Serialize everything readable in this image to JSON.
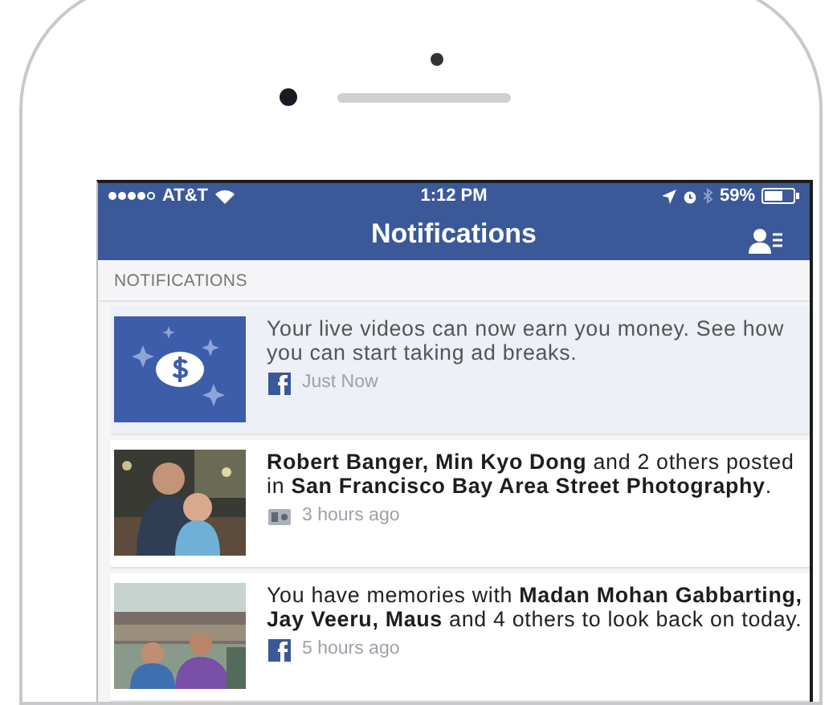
{
  "status_bar": {
    "carrier": "AT&T",
    "time": "1:12 PM",
    "battery": "59%"
  },
  "nav_bar": {
    "title": "Notifications"
  },
  "section_header": "NOTIFICATIONS",
  "notifications": [
    {
      "kind": "money",
      "unread": true,
      "text": "Your live videos can now earn you money. See how you can start taking ad breaks.",
      "source": {
        "kind": "facebook"
      },
      "time": "Just Now"
    },
    {
      "unread": false,
      "text": "**Robert Banger, Min Kyo Dong** and 2 others posted in **San Francisco Bay Area Street Photography**.",
      "source": {
        "kind": "group"
      },
      "time": "3 hours ago"
    },
    {
      "unread": false,
      "text": "You have memories with **Madan Mohan Gabbarting, Jay Veeru, Maus** and 4 others to look back on today.",
      "source": {
        "kind": "facebook"
      },
      "time": "5 hours ago"
    }
  ]
}
